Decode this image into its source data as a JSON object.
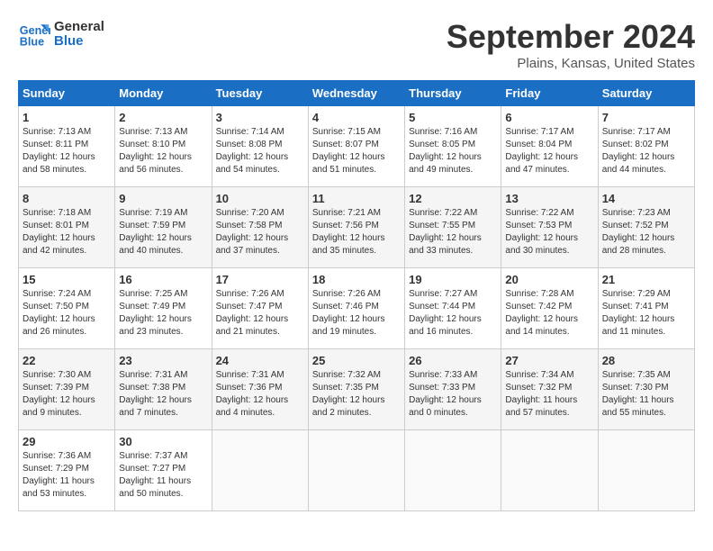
{
  "logo": {
    "line1": "General",
    "line2": "Blue"
  },
  "title": "September 2024",
  "subtitle": "Plains, Kansas, United States",
  "headers": [
    "Sunday",
    "Monday",
    "Tuesday",
    "Wednesday",
    "Thursday",
    "Friday",
    "Saturday"
  ],
  "weeks": [
    [
      {
        "day": "1",
        "info": "Sunrise: 7:13 AM\nSunset: 8:11 PM\nDaylight: 12 hours\nand 58 minutes."
      },
      {
        "day": "2",
        "info": "Sunrise: 7:13 AM\nSunset: 8:10 PM\nDaylight: 12 hours\nand 56 minutes."
      },
      {
        "day": "3",
        "info": "Sunrise: 7:14 AM\nSunset: 8:08 PM\nDaylight: 12 hours\nand 54 minutes."
      },
      {
        "day": "4",
        "info": "Sunrise: 7:15 AM\nSunset: 8:07 PM\nDaylight: 12 hours\nand 51 minutes."
      },
      {
        "day": "5",
        "info": "Sunrise: 7:16 AM\nSunset: 8:05 PM\nDaylight: 12 hours\nand 49 minutes."
      },
      {
        "day": "6",
        "info": "Sunrise: 7:17 AM\nSunset: 8:04 PM\nDaylight: 12 hours\nand 47 minutes."
      },
      {
        "day": "7",
        "info": "Sunrise: 7:17 AM\nSunset: 8:02 PM\nDaylight: 12 hours\nand 44 minutes."
      }
    ],
    [
      {
        "day": "8",
        "info": "Sunrise: 7:18 AM\nSunset: 8:01 PM\nDaylight: 12 hours\nand 42 minutes."
      },
      {
        "day": "9",
        "info": "Sunrise: 7:19 AM\nSunset: 7:59 PM\nDaylight: 12 hours\nand 40 minutes."
      },
      {
        "day": "10",
        "info": "Sunrise: 7:20 AM\nSunset: 7:58 PM\nDaylight: 12 hours\nand 37 minutes."
      },
      {
        "day": "11",
        "info": "Sunrise: 7:21 AM\nSunset: 7:56 PM\nDaylight: 12 hours\nand 35 minutes."
      },
      {
        "day": "12",
        "info": "Sunrise: 7:22 AM\nSunset: 7:55 PM\nDaylight: 12 hours\nand 33 minutes."
      },
      {
        "day": "13",
        "info": "Sunrise: 7:22 AM\nSunset: 7:53 PM\nDaylight: 12 hours\nand 30 minutes."
      },
      {
        "day": "14",
        "info": "Sunrise: 7:23 AM\nSunset: 7:52 PM\nDaylight: 12 hours\nand 28 minutes."
      }
    ],
    [
      {
        "day": "15",
        "info": "Sunrise: 7:24 AM\nSunset: 7:50 PM\nDaylight: 12 hours\nand 26 minutes."
      },
      {
        "day": "16",
        "info": "Sunrise: 7:25 AM\nSunset: 7:49 PM\nDaylight: 12 hours\nand 23 minutes."
      },
      {
        "day": "17",
        "info": "Sunrise: 7:26 AM\nSunset: 7:47 PM\nDaylight: 12 hours\nand 21 minutes."
      },
      {
        "day": "18",
        "info": "Sunrise: 7:26 AM\nSunset: 7:46 PM\nDaylight: 12 hours\nand 19 minutes."
      },
      {
        "day": "19",
        "info": "Sunrise: 7:27 AM\nSunset: 7:44 PM\nDaylight: 12 hours\nand 16 minutes."
      },
      {
        "day": "20",
        "info": "Sunrise: 7:28 AM\nSunset: 7:42 PM\nDaylight: 12 hours\nand 14 minutes."
      },
      {
        "day": "21",
        "info": "Sunrise: 7:29 AM\nSunset: 7:41 PM\nDaylight: 12 hours\nand 11 minutes."
      }
    ],
    [
      {
        "day": "22",
        "info": "Sunrise: 7:30 AM\nSunset: 7:39 PM\nDaylight: 12 hours\nand 9 minutes."
      },
      {
        "day": "23",
        "info": "Sunrise: 7:31 AM\nSunset: 7:38 PM\nDaylight: 12 hours\nand 7 minutes."
      },
      {
        "day": "24",
        "info": "Sunrise: 7:31 AM\nSunset: 7:36 PM\nDaylight: 12 hours\nand 4 minutes."
      },
      {
        "day": "25",
        "info": "Sunrise: 7:32 AM\nSunset: 7:35 PM\nDaylight: 12 hours\nand 2 minutes."
      },
      {
        "day": "26",
        "info": "Sunrise: 7:33 AM\nSunset: 7:33 PM\nDaylight: 12 hours\nand 0 minutes."
      },
      {
        "day": "27",
        "info": "Sunrise: 7:34 AM\nSunset: 7:32 PM\nDaylight: 11 hours\nand 57 minutes."
      },
      {
        "day": "28",
        "info": "Sunrise: 7:35 AM\nSunset: 7:30 PM\nDaylight: 11 hours\nand 55 minutes."
      }
    ],
    [
      {
        "day": "29",
        "info": "Sunrise: 7:36 AM\nSunset: 7:29 PM\nDaylight: 11 hours\nand 53 minutes."
      },
      {
        "day": "30",
        "info": "Sunrise: 7:37 AM\nSunset: 7:27 PM\nDaylight: 11 hours\nand 50 minutes."
      },
      {
        "day": "",
        "info": ""
      },
      {
        "day": "",
        "info": ""
      },
      {
        "day": "",
        "info": ""
      },
      {
        "day": "",
        "info": ""
      },
      {
        "day": "",
        "info": ""
      }
    ]
  ]
}
